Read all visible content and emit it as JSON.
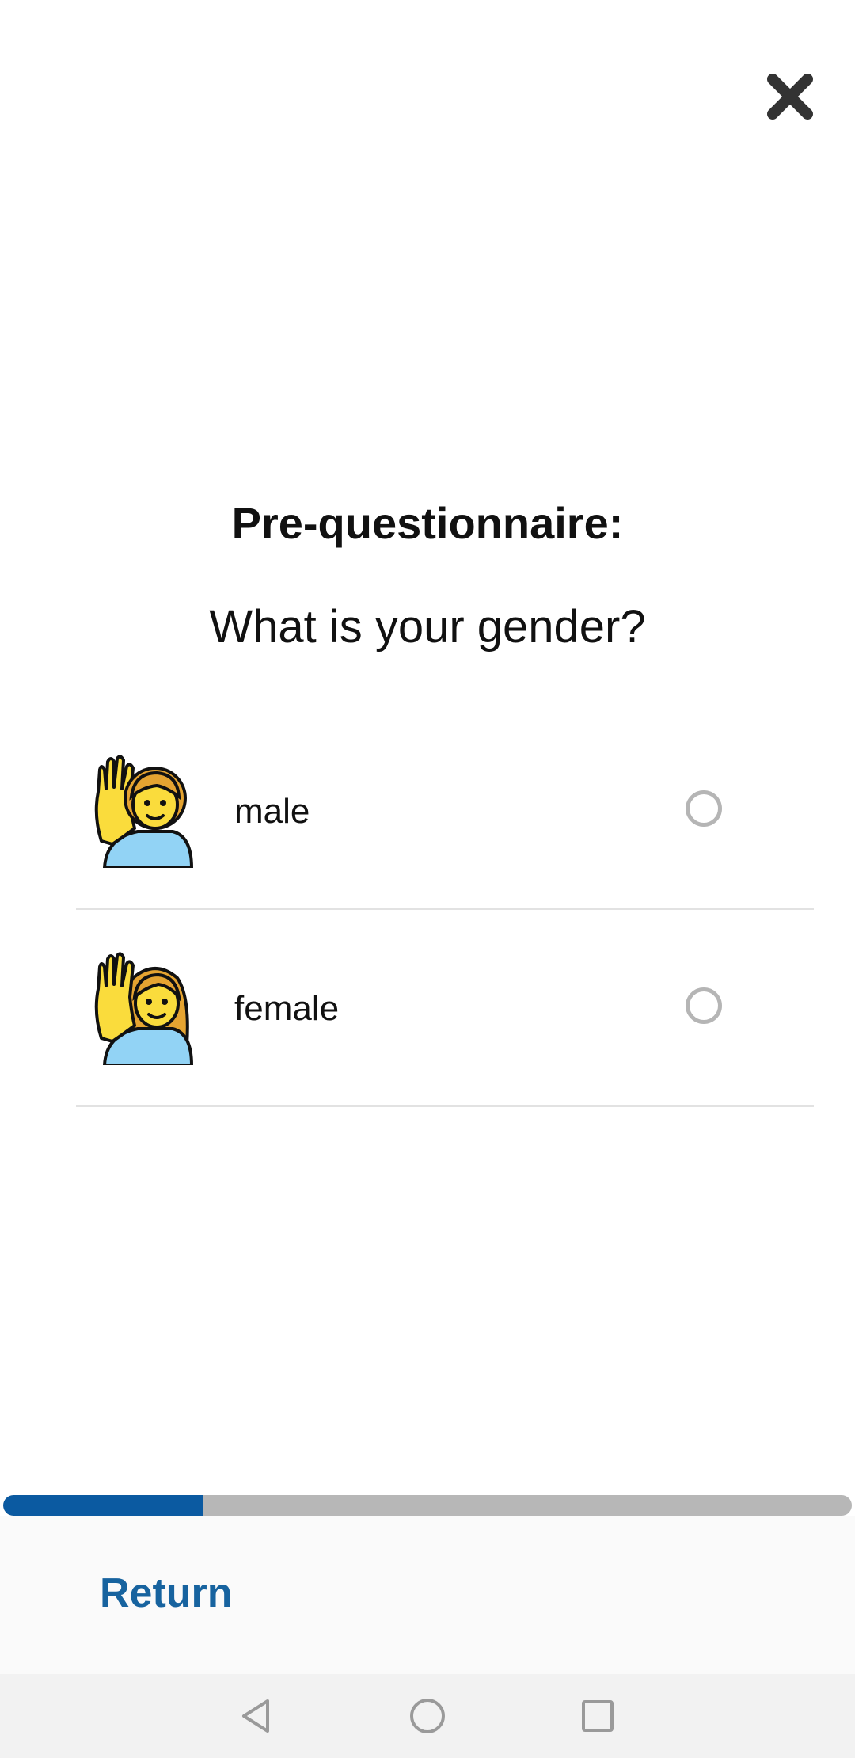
{
  "header": {
    "close_icon": "close-icon"
  },
  "content": {
    "title": "Pre-questionnaire:",
    "question": "What is your gender?"
  },
  "options": [
    {
      "label": "male",
      "icon": "person-raising-hand-man-icon",
      "selected": false
    },
    {
      "label": "female",
      "icon": "person-raising-hand-woman-icon",
      "selected": false
    }
  ],
  "progress": {
    "fraction": 0.235,
    "fill_color": "#0b5aa1",
    "track_color": "#b7b7b7"
  },
  "footer": {
    "return_label": "Return",
    "return_color": "#17639f"
  },
  "navbar": {
    "back_icon": "back-triangle-icon",
    "home_icon": "home-circle-icon",
    "recent_icon": "recent-apps-square-icon"
  }
}
